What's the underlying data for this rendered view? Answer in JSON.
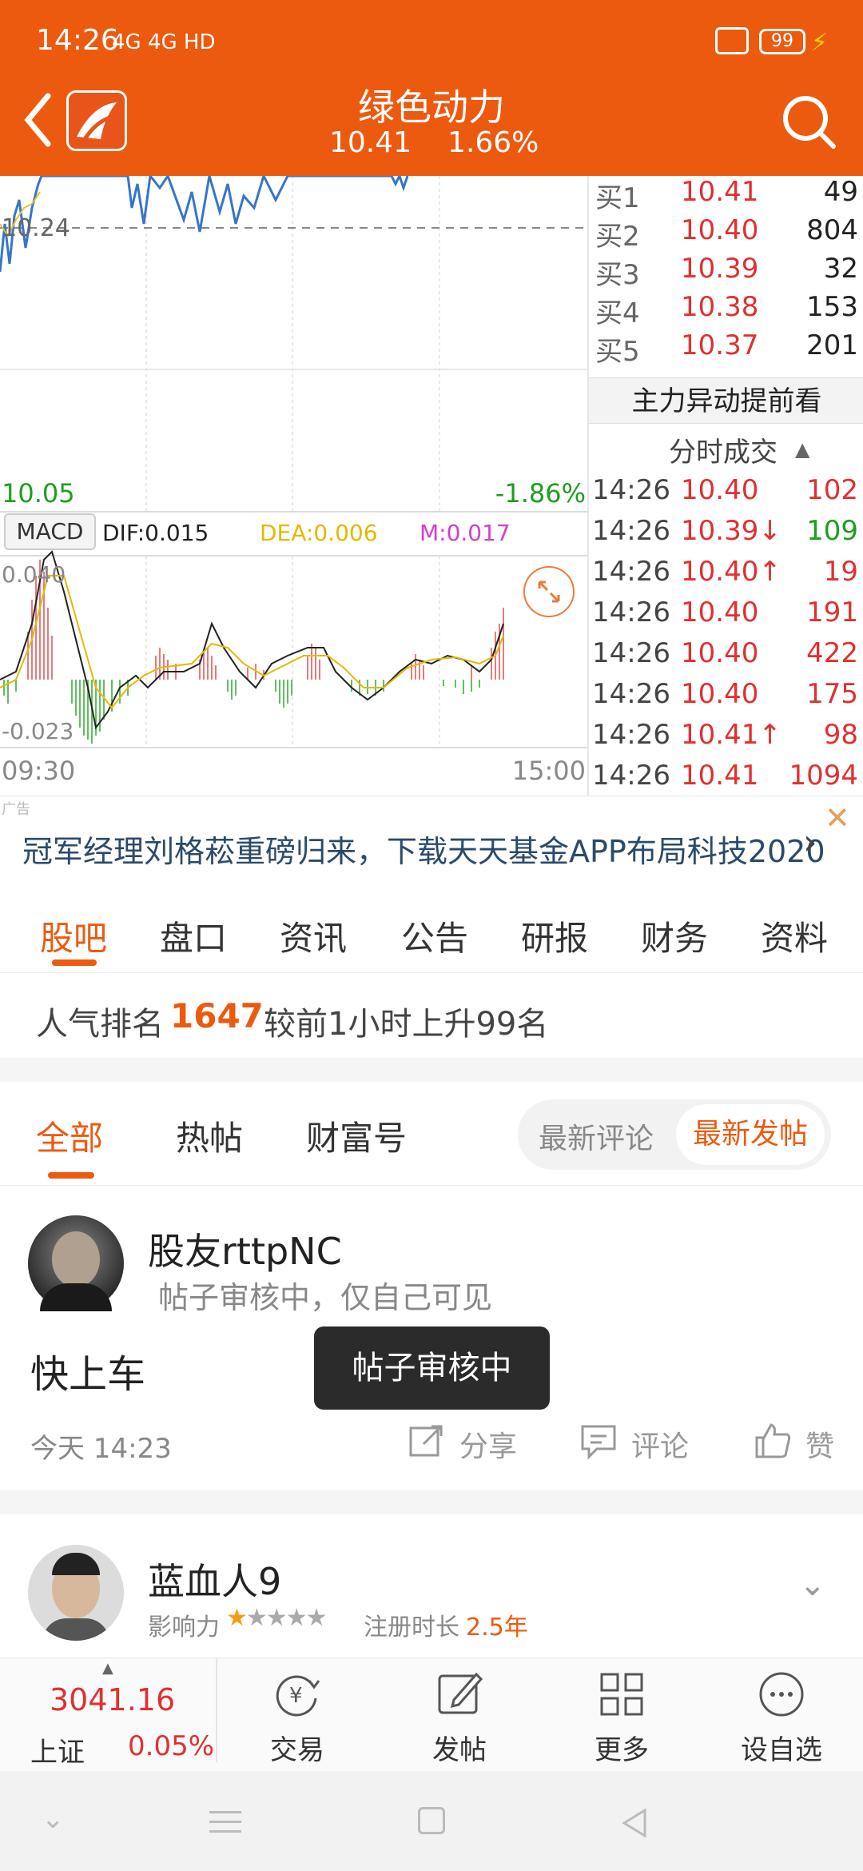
{
  "status": {
    "time": "14:26",
    "net": "4G 4G HD",
    "battery": "99"
  },
  "header": {
    "title": "绿色动力",
    "price": "10.41",
    "pct": "1.66%"
  },
  "chart": {
    "ref_label": "10.24",
    "low_label": "10.05",
    "low_pct": "-1.86%",
    "macd_btn": "MACD",
    "dif": "DIF:0.015",
    "dea": "DEA:0.006",
    "m": "M:0.017",
    "macd_top": "0.040",
    "macd_bottom": "-0.023",
    "time_start": "09:30",
    "time_end": "15:00"
  },
  "orderbook": {
    "bids": [
      {
        "label": "买1",
        "price": "10.41",
        "vol": "49"
      },
      {
        "label": "买2",
        "price": "10.40",
        "vol": "804"
      },
      {
        "label": "买3",
        "price": "10.39",
        "vol": "32"
      },
      {
        "label": "买4",
        "price": "10.38",
        "vol": "153"
      },
      {
        "label": "买5",
        "price": "10.37",
        "vol": "201"
      }
    ],
    "main_title": "主力异动提前看",
    "trades_title": "分时成交",
    "trades": [
      {
        "time": "14:26",
        "price": "10.40",
        "vol": "102",
        "arrow": ""
      },
      {
        "time": "14:26",
        "price": "10.39↓",
        "vol": "109",
        "arrow": "down"
      },
      {
        "time": "14:26",
        "price": "10.40↑",
        "vol": "19",
        "arrow": "up"
      },
      {
        "time": "14:26",
        "price": "10.40",
        "vol": "191",
        "arrow": ""
      },
      {
        "time": "14:26",
        "price": "10.40",
        "vol": "422",
        "arrow": ""
      },
      {
        "time": "14:26",
        "price": "10.40",
        "vol": "175",
        "arrow": ""
      },
      {
        "time": "14:26",
        "price": "10.41↑",
        "vol": "98",
        "arrow": "up"
      },
      {
        "time": "14:26",
        "price": "10.41",
        "vol": "1094",
        "arrow": ""
      }
    ]
  },
  "ad": {
    "tag": "广告",
    "text": "冠军经理刘格菘重磅归来，下载天天基金APP布局科技2020"
  },
  "tabs": [
    "股吧",
    "盘口",
    "资讯",
    "公告",
    "研报",
    "财务",
    "资料"
  ],
  "rank": {
    "label": "人气排名",
    "value": "1647",
    "change": "较前1小时上升99名"
  },
  "subtabs": [
    "全部",
    "热帖",
    "财富号"
  ],
  "sort": {
    "latest_comment": "最新评论",
    "latest_post": "最新发帖"
  },
  "post1": {
    "user": "股友rttpNC",
    "status": "帖子审核中，仅自己可见",
    "content": "快上车",
    "time": "今天 14:23",
    "share": "分享",
    "comment": "评论",
    "like": "赞"
  },
  "toast": "帖子审核中",
  "post2": {
    "user": "蓝血人9",
    "influence": "影响力",
    "reg_label": "注册时长",
    "reg_value": "2.5年"
  },
  "bottom": {
    "index_value": "3041.16",
    "index_name": "上证",
    "index_pct": "0.05%",
    "trade": "交易",
    "post": "发帖",
    "more": "更多",
    "watch": "设自选"
  },
  "colors": {
    "brand": "#ec5a0f",
    "up": "#e03030",
    "down": "#1e9e1e"
  }
}
